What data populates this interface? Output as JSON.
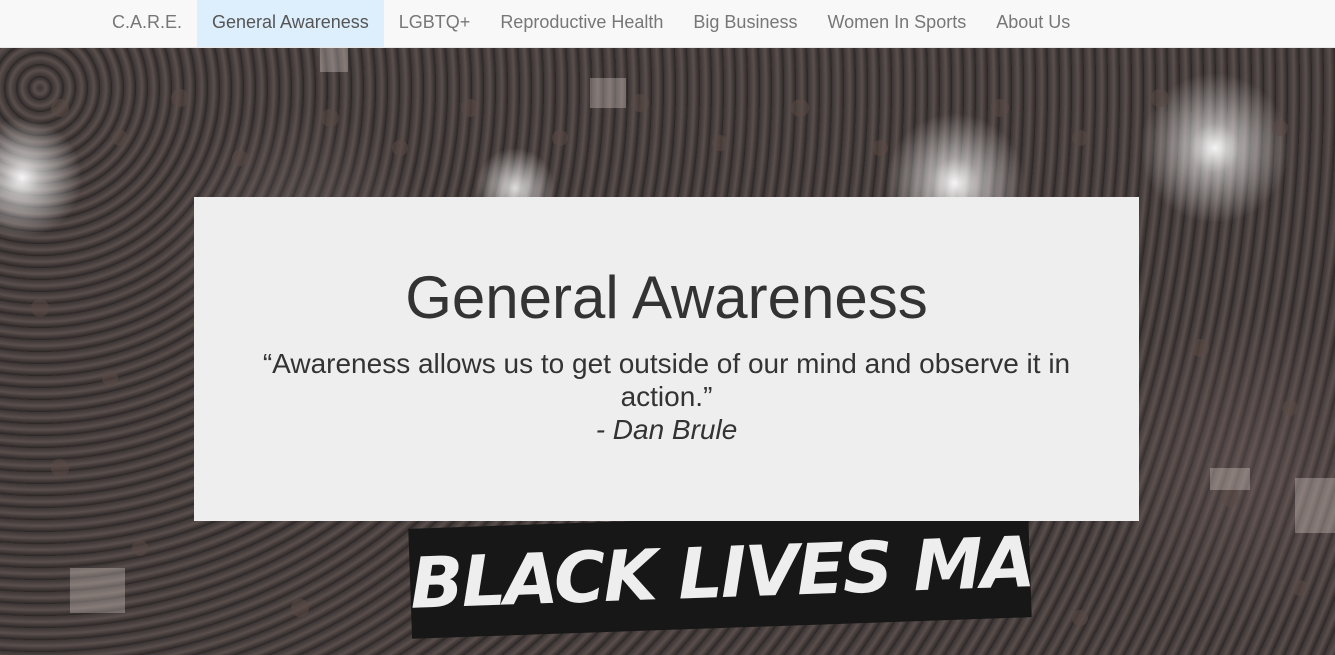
{
  "nav": {
    "items": [
      {
        "label": "C.A.R.E.",
        "active": false
      },
      {
        "label": "General Awareness",
        "active": true
      },
      {
        "label": "LGBTQ+",
        "active": false
      },
      {
        "label": "Reproductive Health",
        "active": false
      },
      {
        "label": "Big Business",
        "active": false
      },
      {
        "label": "Women In Sports",
        "active": false
      },
      {
        "label": "About Us",
        "active": false
      }
    ]
  },
  "hero": {
    "banner_text": "BLACK LIVES MATTER"
  },
  "jumbotron": {
    "title": "General Awareness",
    "quote": "“Awareness allows us to get outside of our mind and observe it in action.”",
    "author": "- Dan Brule"
  },
  "colors": {
    "nav_background": "#f8f8f8",
    "nav_active_background": "#ddeefc",
    "jumbotron_background": "#eeeeee",
    "text": "#333333"
  }
}
